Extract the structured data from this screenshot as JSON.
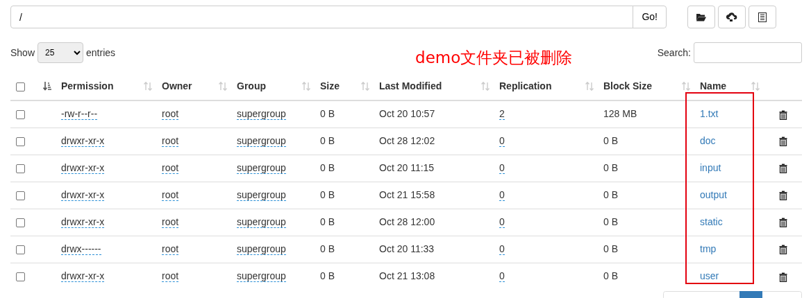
{
  "path_bar": {
    "value": "/",
    "go_button": "Go!"
  },
  "length_menu": {
    "label_before": "Show",
    "value": "25",
    "label_after": "entries"
  },
  "annotation": "demo文件夹已被删除",
  "search": {
    "label": "Search:"
  },
  "table": {
    "select_all": {
      "checked": false,
      "sorted": true
    },
    "columns": [
      {
        "label": "Permission",
        "sorted": false
      },
      {
        "label": "Owner",
        "sorted": false
      },
      {
        "label": "Group",
        "sorted": false
      },
      {
        "label": "Size",
        "sorted": false
      },
      {
        "label": "Last Modified",
        "sorted": false
      },
      {
        "label": "Replication",
        "sorted": false
      },
      {
        "label": "Block Size",
        "sorted": false
      },
      {
        "label": "Name",
        "sorted": false
      }
    ],
    "rows": [
      {
        "checked": false,
        "permission": "-rw-r--r--",
        "owner": "root",
        "group": "supergroup",
        "size": "0 B",
        "modified": "Oct 20 10:57",
        "replication": "2",
        "block_size": "128 MB",
        "name": "1.txt"
      },
      {
        "checked": false,
        "permission": "drwxr-xr-x",
        "owner": "root",
        "group": "supergroup",
        "size": "0 B",
        "modified": "Oct 28 12:02",
        "replication": "0",
        "block_size": "0 B",
        "name": "doc"
      },
      {
        "checked": false,
        "permission": "drwxr-xr-x",
        "owner": "root",
        "group": "supergroup",
        "size": "0 B",
        "modified": "Oct 20 11:15",
        "replication": "0",
        "block_size": "0 B",
        "name": "input"
      },
      {
        "checked": false,
        "permission": "drwxr-xr-x",
        "owner": "root",
        "group": "supergroup",
        "size": "0 B",
        "modified": "Oct 21 15:58",
        "replication": "0",
        "block_size": "0 B",
        "name": "output"
      },
      {
        "checked": false,
        "permission": "drwxr-xr-x",
        "owner": "root",
        "group": "supergroup",
        "size": "0 B",
        "modified": "Oct 28 12:00",
        "replication": "0",
        "block_size": "0 B",
        "name": "static"
      },
      {
        "checked": false,
        "permission": "drwx------",
        "owner": "root",
        "group": "supergroup",
        "size": "0 B",
        "modified": "Oct 20 11:33",
        "replication": "0",
        "block_size": "0 B",
        "name": "tmp"
      },
      {
        "checked": false,
        "permission": "drwxr-xr-x",
        "owner": "root",
        "group": "supergroup",
        "size": "0 B",
        "modified": "Oct 21 13:08",
        "replication": "0",
        "block_size": "0 B",
        "name": "user"
      }
    ]
  }
}
